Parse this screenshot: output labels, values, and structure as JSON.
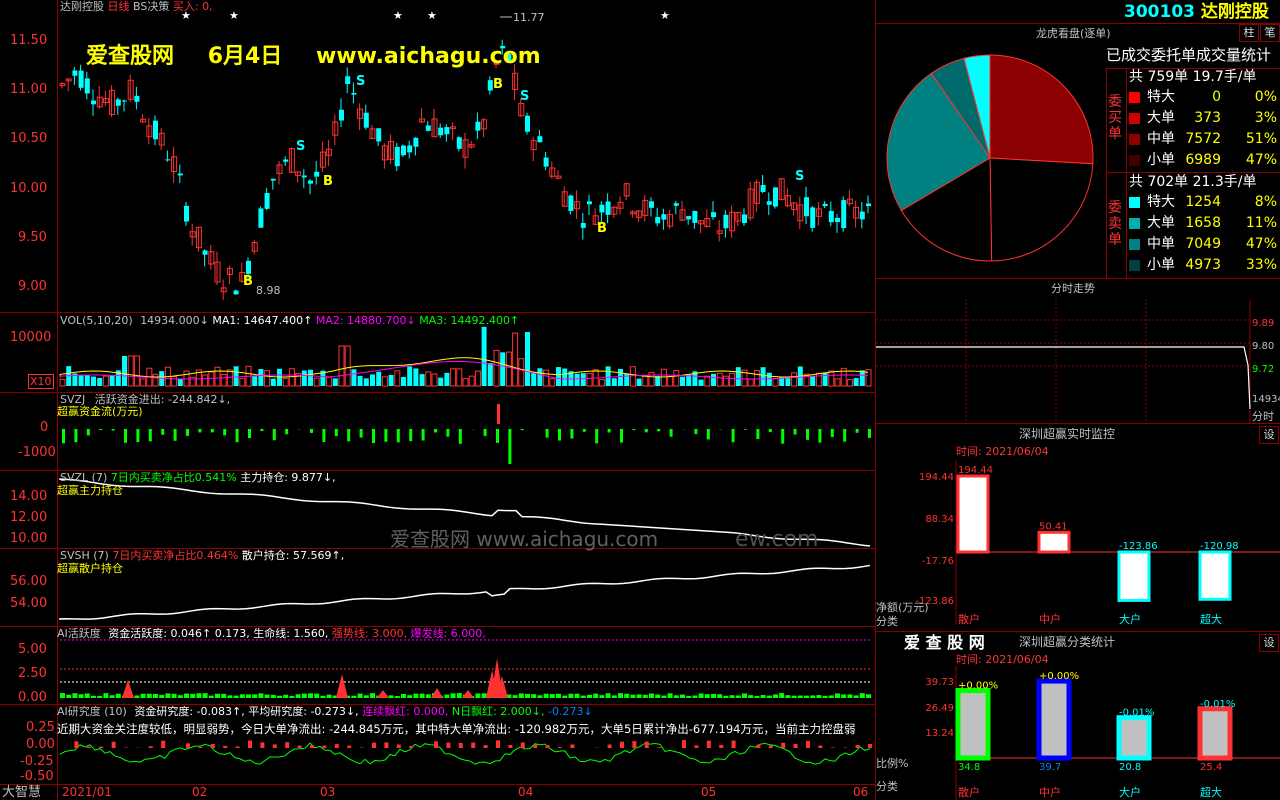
{
  "main": {
    "stock_name": "达刚控股",
    "period": "日线",
    "strategy": "BS决策",
    "buy_label": "买入:",
    "buy_value": "0,",
    "high_mark": "11.77",
    "low_mark": "8.98",
    "y_labels": [
      "11.50",
      "11.00",
      "10.50",
      "10.00",
      "9.50",
      "9.00"
    ],
    "signal_s": "S",
    "signal_b": "B"
  },
  "watermark": {
    "site_name": "爱查股网",
    "date": "6月4日",
    "url": "www.aichagu.com",
    "mid_text": "爱查股网   www.aichagu.com",
    "mid_suffix": "ew.com"
  },
  "vol": {
    "header": "VOL(5,10,20)",
    "value": "14934.000↓",
    "ma1": "MA1: 14647.400↑",
    "ma2": "MA2: 14880.700↓",
    "ma3": "MA3: 14492.400↑",
    "y_label": "10000",
    "unit": "X10"
  },
  "svzj": {
    "header": "SVZJ",
    "desc": "活跃资金进出: -244.842↓,",
    "sub": "超赢资金流(万元)",
    "y_labels": [
      "0",
      "-1000"
    ]
  },
  "svzl": {
    "header": "SVZL  (7)",
    "ratio": "7日内买卖净占比0.541%",
    "desc": "主力持仓: 9.877↓,",
    "sub": "超赢主力持仓",
    "y_labels": [
      "14.00",
      "12.00",
      "10.00"
    ]
  },
  "svsh": {
    "header": "SVSH  (7)",
    "ratio": "7日内买卖净占比0.464%",
    "desc": "散户持仓: 57.569↑,",
    "sub": "超赢散户持仓",
    "y_labels": [
      "56.00",
      "54.00"
    ]
  },
  "ai_active": {
    "header": "AI活跃度",
    "v1": "资金活跃度: 0.046↑",
    "v2": "0.173,",
    "v3": "生命线: 1.560,",
    "v4": "强势线: 3.000,",
    "v5": "爆发线: 6.000,",
    "y_labels": [
      "5.00",
      "2.50",
      "0.00"
    ]
  },
  "ai_research": {
    "header": "AI研究度 (10)",
    "v1": "资金研究度: -0.083↑,",
    "v2": "平均研究度: -0.273↓,",
    "v3": "连续飘红: 0.000,",
    "v4": "N日飘红: 2.000↓,",
    "v5": "-0.273↓",
    "note": "近期大资金关注度较低，明显弱势，今日大单净流出: -244.845万元，其中特大单净流出: -120.982万元，大单5日累计净出-677.194万元，当前主力控盘弱",
    "y_labels": [
      "0.25",
      "0.00",
      "-0.25",
      "-0.50"
    ]
  },
  "timeline": {
    "brand": "大智慧",
    "labels": [
      "2021/01",
      "02",
      "03",
      "04",
      "05",
      "06"
    ]
  },
  "right": {
    "code": "300103",
    "name": "达刚控股",
    "btn_zhu": "柱",
    "btn_bi": "笔",
    "dragon_title": "龙虎看盘(逐单)",
    "stats_title": "已成交委托单成交量统计",
    "buy_group_label": "委买单",
    "sell_group_label": "委卖单",
    "buy_total": "共 759单 19.7手/单",
    "sell_total": "共 702单 21.3手/单",
    "buy_rows": [
      {
        "label": "特大",
        "value": "0",
        "pct": "0%",
        "color": "#ff0000"
      },
      {
        "label": "大单",
        "value": "373",
        "pct": "3%",
        "color": "#cc0000"
      },
      {
        "label": "中单",
        "value": "7572",
        "pct": "51%",
        "color": "#8b0000"
      },
      {
        "label": "小单",
        "value": "6989",
        "pct": "47%",
        "color": "#400000"
      }
    ],
    "sell_rows": [
      {
        "label": "特大",
        "value": "1254",
        "pct": "8%",
        "color": "#00ffff"
      },
      {
        "label": "大单",
        "value": "1658",
        "pct": "11%",
        "color": "#00b0b0"
      },
      {
        "label": "中单",
        "value": "7049",
        "pct": "47%",
        "color": "#008080"
      },
      {
        "label": "小单",
        "value": "4973",
        "pct": "33%",
        "color": "#004040"
      }
    ],
    "intraday_title": "分时走势",
    "intraday_prices": [
      "9.89",
      "9.80",
      "9.72"
    ],
    "intraday_vol": "14934",
    "intraday_unit": "分时",
    "monitor_title": "深圳超赢实时监控",
    "monitor_btn": "设",
    "monitor_time": "时间: 2021/06/04",
    "monitor_y": [
      "194.44",
      "88.34",
      "-17.76",
      "-123.86"
    ],
    "monitor_bars": [
      {
        "label": "散户",
        "value": "194.44"
      },
      {
        "label": "中户",
        "value": "50.41"
      },
      {
        "label": "大户",
        "value": "-123.86"
      },
      {
        "label": "超大",
        "value": "-120.98"
      }
    ],
    "monitor_ylabel": "净额(万元)",
    "monitor_xlabel": "分类",
    "class_logo": "爱 查 股 网",
    "class_title": "深圳超赢分类统计",
    "class_btn": "设",
    "class_time": "时间: 2021/06/04",
    "class_y": [
      "39.73",
      "26.49",
      "13.24"
    ],
    "class_bars": [
      {
        "label": "散户",
        "value": "34.8",
        "change": "+0.00%"
      },
      {
        "label": "中户",
        "value": "39.7",
        "change": "+0.00%"
      },
      {
        "label": "大户",
        "value": "20.8",
        "change": "-0.01%"
      },
      {
        "label": "超大",
        "value": "25.4",
        "change": "-0.01%"
      }
    ],
    "class_ylabel": "比例%",
    "class_xlabel": "分类"
  },
  "colors": {
    "up": "#ff3232",
    "down": "#00ffff",
    "grid": "#8b0000",
    "yellow": "#ffff00",
    "magenta": "#ff00ff",
    "green": "#00ff00"
  }
}
